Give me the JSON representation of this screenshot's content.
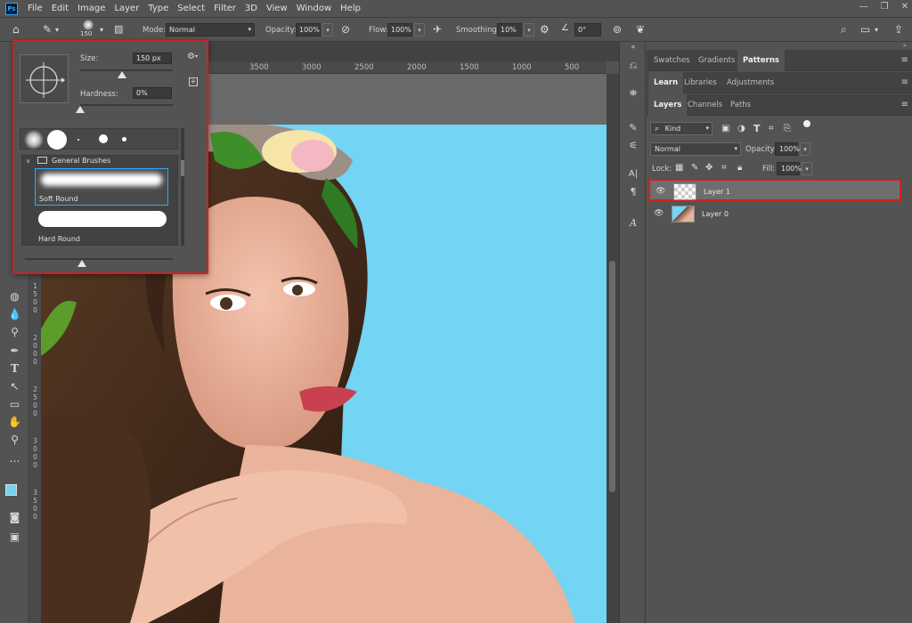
{
  "app": {
    "logo": "Ps",
    "menu": [
      "File",
      "Edit",
      "Image",
      "Layer",
      "Type",
      "Select",
      "Filter",
      "3D",
      "View",
      "Window",
      "Help"
    ],
    "window_controls": [
      "—",
      "❐",
      "✕"
    ]
  },
  "options_bar": {
    "brush_size": "150",
    "mode_label": "Mode:",
    "mode_value": "Normal",
    "opacity_label": "Opacity:",
    "opacity_value": "100%",
    "flow_label": "Flow:",
    "flow_value": "100%",
    "smoothing_label": "Smoothing:",
    "smoothing_value": "10%",
    "angle_value": "0°"
  },
  "ruler": {
    "top_ticks": [
      "3500",
      "3000",
      "2500",
      "2000",
      "1500",
      "1000",
      "500"
    ],
    "left_ticks": [
      "1500",
      "2000",
      "2500",
      "3000",
      "3500"
    ]
  },
  "brush_popup": {
    "size_label": "Size:",
    "size_value": "150 px",
    "size_fraction": 0.45,
    "hardness_label": "Hardness:",
    "hardness_value": "0%",
    "hardness_fraction": 0.0,
    "folder_name": "General Brushes",
    "brushes": [
      {
        "name": "Soft Round",
        "selected": true
      },
      {
        "name": "Hard Round",
        "selected": false
      }
    ]
  },
  "panels": {
    "row1_tabs": [
      "Swatches",
      "Gradients",
      "Patterns"
    ],
    "row1_active": "Patterns",
    "row2_tabs": [
      "Learn",
      "Libraries",
      "Adjustments"
    ],
    "row2_active": "Learn",
    "row3_tabs": [
      "Layers",
      "Channels",
      "Paths"
    ],
    "row3_active": "Layers",
    "filter_kind": "Kind",
    "blend_mode": "Normal",
    "opacity_label": "Opacity:",
    "opacity_value": "100%",
    "lock_label": "Lock:",
    "fill_label": "Fill:",
    "fill_value": "100%",
    "layers": [
      {
        "name": "Layer 1",
        "selected": true
      },
      {
        "name": "Layer 0",
        "selected": false
      }
    ]
  },
  "colors": {
    "highlight_red": "#d21f1f",
    "selected_blue": "#31a8ff",
    "photo_background": "#74d4f3"
  }
}
